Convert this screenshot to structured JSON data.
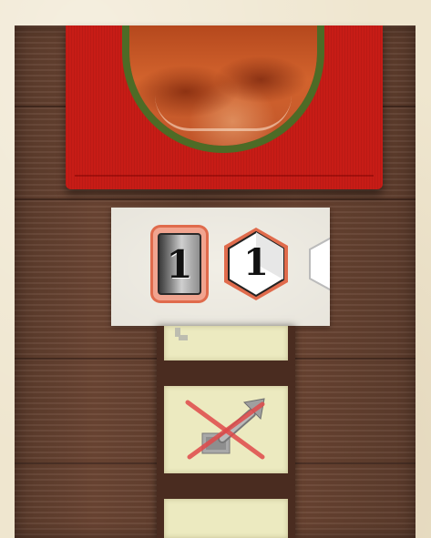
{
  "board": {
    "tiles": [
      {
        "kind": "square-tile",
        "value": "1"
      },
      {
        "kind": "hex-tile",
        "value": "1"
      },
      {
        "kind": "hex-tile-partial",
        "value": ""
      }
    ]
  },
  "colors": {
    "banner_red": "#c71c16",
    "medallion_green": "#4d6b26",
    "tile_highlight": "#e06b4c",
    "wood": "#5f3d2d",
    "slot_cream": "#eceac0",
    "cross_red": "#e04a4a"
  },
  "icons": {
    "planet": "planet-medallion-icon",
    "arrow": "arrow-up-right-icon",
    "forbidden": "cross-out-icon"
  }
}
